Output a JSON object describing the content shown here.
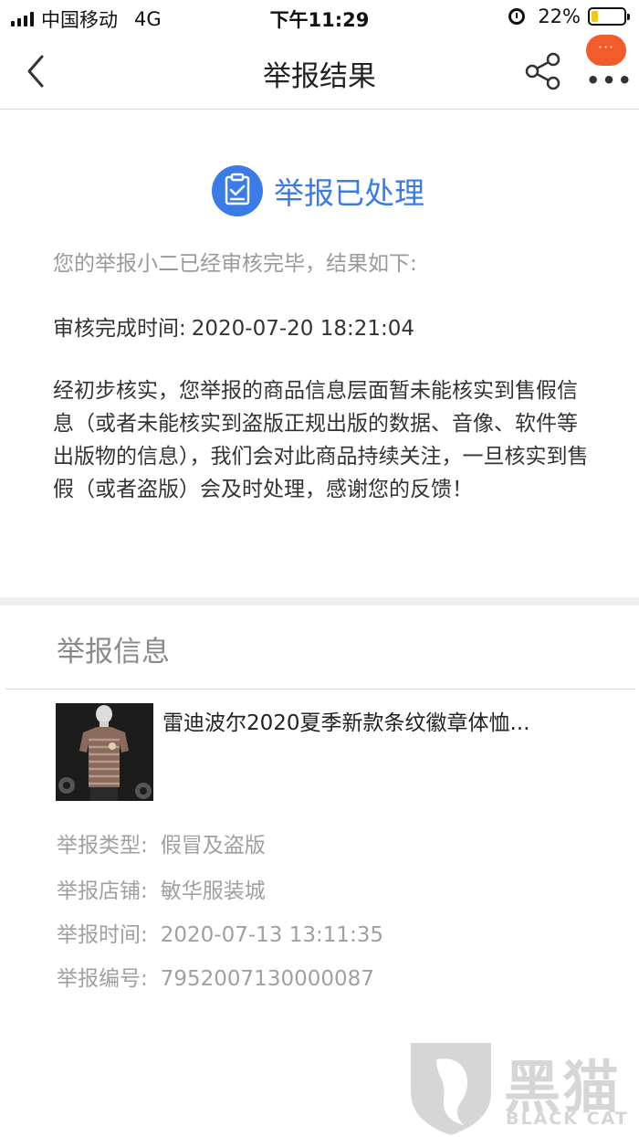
{
  "status_bar": {
    "carrier": "中国移动",
    "network": "4G",
    "time": "下午11:29",
    "battery_percent": "22%",
    "battery_level": 0.22,
    "battery_color": "#f5c518"
  },
  "nav": {
    "title": "举报结果",
    "back_icon": "chevron-left-icon",
    "share_icon": "share-icon",
    "more_bubble": "···",
    "more_dots": "•••",
    "accent_color": "#f25c2b"
  },
  "result": {
    "status_title": "举报已处理",
    "status_icon": "document-check-icon",
    "status_color": "#3b7be8",
    "intro": "您的举报小二已经审核完毕，结果如下:",
    "review_time_label": "审核完成时间:",
    "review_time_value": "2020-07-20 18:21:04",
    "body": "经初步核实，您举报的商品信息层面暂未能核实到售假信息（或者未能核实到盗版正规出版的数据、音像、软件等出版物的信息），我们会对此商品持续关注，一旦核实到售假（或者盗版）会及时处理，感谢您的反馈！"
  },
  "report_info": {
    "title": "举报信息",
    "product_name": "雷迪波尔2020夏季新款条纹徽章体恤...",
    "rows": [
      {
        "label": "举报类型:",
        "value": "假冒及盗版"
      },
      {
        "label": "举报店铺:",
        "value": "敏华服装城"
      },
      {
        "label": "举报时间:",
        "value": "2020-07-13 13:11:35"
      },
      {
        "label": "举报编号:",
        "value": "7952007130000087"
      }
    ]
  },
  "watermark": {
    "text_cn": "黑猫",
    "text_en": "BLACK CAT"
  }
}
